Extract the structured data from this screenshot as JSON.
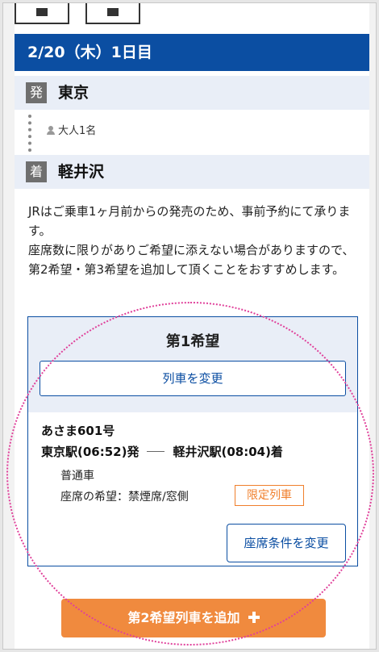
{
  "day_header": "2/20（木）1日目",
  "departure": {
    "badge": "発",
    "station": "東京"
  },
  "passengers": "大人1名",
  "arrival": {
    "badge": "着",
    "station": "軽井沢"
  },
  "notice": [
    "JRはご乗車1ヶ月前からの発売のため、事前予約にて承ります。",
    "座席数に限りがありご希望に添えない場合がありますので、第2希望・第3希望を追加して頂くことをおすすめします。"
  ],
  "choice": {
    "title": "第1希望",
    "change_train_label": "列車を変更",
    "train_name": "あさま601号",
    "from": "東京駅(06:52)発",
    "to": "軽井沢駅(08:04)着",
    "car_class": "普通車",
    "seat_pref": "座席の希望：禁煙席/窓側",
    "limited_badge": "限定列車",
    "seat_change_label": "座席条件を変更"
  },
  "add_train_label": "第2希望列車を追加",
  "colors": {
    "header_blue": "#0b4ea2",
    "accent_orange": "#f08a3e",
    "highlight_pink": "#e0409a"
  },
  "icons": [
    "person-icon",
    "plus-icon"
  ]
}
